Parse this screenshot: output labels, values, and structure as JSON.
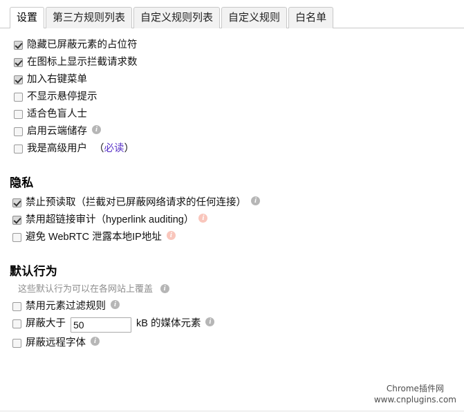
{
  "tabs": [
    {
      "label": "设置",
      "active": true
    },
    {
      "label": "第三方规则列表",
      "active": false
    },
    {
      "label": "自定义规则列表",
      "active": false
    },
    {
      "label": "自定义规则",
      "active": false
    },
    {
      "label": "白名单",
      "active": false
    }
  ],
  "general_options": [
    {
      "label": "隐藏已屏蔽元素的占位符",
      "checked": true,
      "info": false
    },
    {
      "label": "在图标上显示拦截请求数",
      "checked": true,
      "info": false
    },
    {
      "label": "加入右键菜单",
      "checked": true,
      "info": false
    },
    {
      "label": "不显示悬停提示",
      "checked": false,
      "info": false
    },
    {
      "label": "适合色盲人士",
      "checked": false,
      "info": false
    },
    {
      "label": "启用云端储存",
      "checked": false,
      "info": true,
      "info_color": "grey"
    }
  ],
  "advanced_user": {
    "label": "我是高级用户",
    "checked": false,
    "open_paren": "（",
    "link_text": "必读",
    "close_paren": "）"
  },
  "privacy": {
    "heading": "隐私",
    "options": [
      {
        "label": "禁止预读取（拦截对已屏蔽网络请求的任何连接）",
        "checked": true,
        "info": true,
        "info_color": "grey"
      },
      {
        "label": "禁用超链接审计（hyperlink auditing）",
        "checked": true,
        "info": true,
        "info_color": "pink"
      },
      {
        "label": "避免 WebRTC 泄露本地IP地址",
        "checked": false,
        "info": true,
        "info_color": "pink"
      }
    ]
  },
  "default_behavior": {
    "heading": "默认行为",
    "note": "这些默认行为可以在各网站上覆盖",
    "note_info_color": "grey",
    "options": [
      {
        "label": "禁用元素过滤规则",
        "checked": false,
        "info": true,
        "info_color": "grey"
      },
      {
        "label": "屏蔽远程字体",
        "checked": false,
        "info": true,
        "info_color": "grey"
      }
    ],
    "media_size_rule": {
      "checked": false,
      "prefix": "屏蔽大于",
      "value": "50",
      "placeholder": "",
      "suffix": "kB 的媒体元素",
      "info_color": "grey"
    }
  },
  "watermark": {
    "line1": "Chrome插件网",
    "line2": "www.cnplugins.com"
  },
  "colors": {
    "link": "#5a34c8",
    "info_grey": "#b6b6b6",
    "info_pink": "#f9c6bc",
    "tab_border": "#c8c8c8",
    "tab_inactive_bg": "#f2f2f2"
  }
}
